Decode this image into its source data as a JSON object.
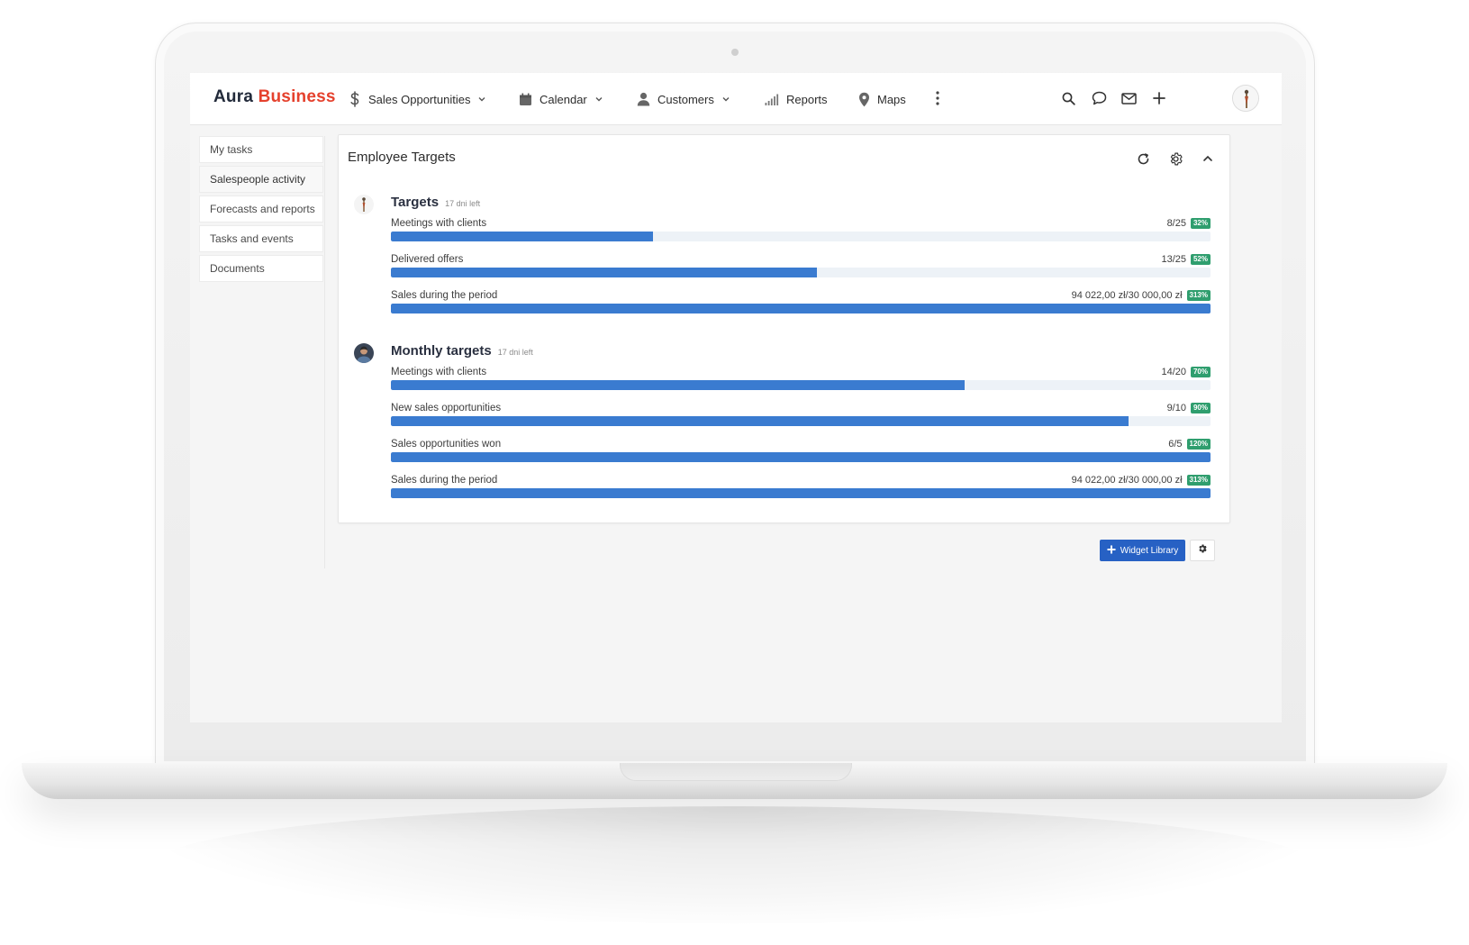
{
  "brand": {
    "part1": "Aura",
    "part2": "Business"
  },
  "nav": {
    "items": [
      {
        "label": "Sales Opportunities",
        "icon": "dollar-icon",
        "dropdown": true
      },
      {
        "label": "Calendar",
        "icon": "calendar-icon",
        "dropdown": true
      },
      {
        "label": "Customers",
        "icon": "user-icon",
        "dropdown": true
      },
      {
        "label": "Reports",
        "icon": "signal-bars-icon",
        "dropdown": false
      },
      {
        "label": "Maps",
        "icon": "map-pin-icon",
        "dropdown": false
      }
    ],
    "right_icons": [
      "search-icon",
      "chat-icon",
      "mail-icon",
      "plus-icon",
      "avatar"
    ]
  },
  "sidebar": {
    "items": [
      {
        "label": "My tasks"
      },
      {
        "label": "Salespeople activity",
        "active": true
      },
      {
        "label": "Forecasts and reports"
      },
      {
        "label": "Tasks and events"
      },
      {
        "label": "Documents"
      }
    ]
  },
  "widget": {
    "title": "Employee Targets",
    "tools": [
      "refresh-icon",
      "settings-icon",
      "collapse-icon"
    ],
    "groups": [
      {
        "title": "Targets",
        "subtitle": "17 dni left",
        "rows": [
          {
            "label": "Meetings with clients",
            "value": "8/25",
            "badge": "32%",
            "progress": 0.32
          },
          {
            "label": "Delivered offers",
            "value": "13/25",
            "badge": "52%",
            "progress": 0.52
          },
          {
            "label": "Sales during the period",
            "value": "94 022,00 zł/30 000,00 zł",
            "badge": "313%",
            "progress": 1.0
          }
        ]
      },
      {
        "title": "Monthly targets",
        "subtitle": "17 dni left",
        "rows": [
          {
            "label": "Meetings with clients",
            "value": "14/20",
            "badge": "70%",
            "progress": 0.7
          },
          {
            "label": "New sales opportunities",
            "value": "9/10",
            "badge": "90%",
            "progress": 0.9
          },
          {
            "label": "Sales opportunities won",
            "value": "6/5",
            "badge": "120%",
            "progress": 1.0
          },
          {
            "label": "Sales during the period",
            "value": "94 022,00 zł/30 000,00 zł",
            "badge": "313%",
            "progress": 1.0
          }
        ]
      }
    ]
  },
  "footer": {
    "widget_library_label": "Widget Library"
  },
  "colors": {
    "accent": "#3a7bd0",
    "brand_red": "#e5412d",
    "badge_green": "#2f9e6e",
    "button_blue": "#2761c4"
  }
}
